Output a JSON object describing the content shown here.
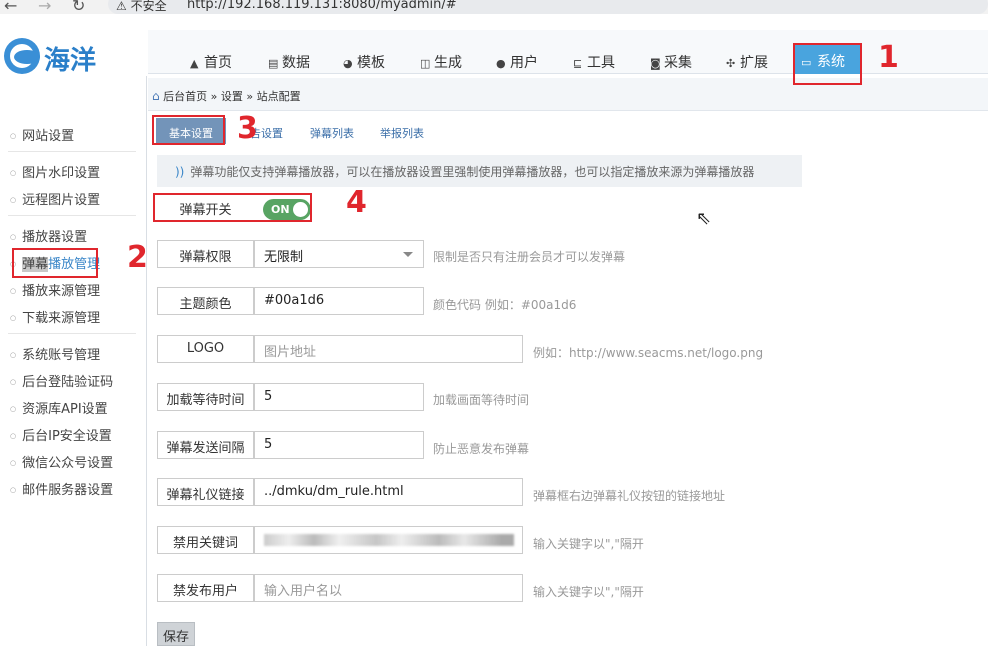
{
  "browser": {
    "security_label": "不安全",
    "url": "http://192.168.119.131:8080/myadmin/#"
  },
  "logo_text": "海洋",
  "topnav": [
    {
      "label": "首页",
      "icon": "home-icon"
    },
    {
      "label": "数据",
      "icon": "data-icon"
    },
    {
      "label": "模板",
      "icon": "palette-icon"
    },
    {
      "label": "生成",
      "icon": "generate-icon"
    },
    {
      "label": "用户",
      "icon": "user-icon"
    },
    {
      "label": "工具",
      "icon": "tools-icon"
    },
    {
      "label": "采集",
      "icon": "collect-icon"
    },
    {
      "label": "扩展",
      "icon": "extend-icon"
    },
    {
      "label": "系统",
      "icon": "monitor-icon"
    }
  ],
  "breadcrumb": "后台首页 » 设置 » 站点配置",
  "sidebar": {
    "items": [
      "网站设置",
      "图片水印设置",
      "远程图片设置",
      "播放器设置",
      "弹幕播放管理",
      "播放来源管理",
      "下载来源管理",
      "系统账号管理",
      "后台登陆验证码",
      "资源库API设置",
      "后台IP安全设置",
      "微信公众号设置",
      "邮件服务器设置"
    ],
    "active_prefix": "弹幕",
    "active_suffix": "播放管理"
  },
  "tabs": [
    "基本设置",
    "告设置",
    "弹幕列表",
    "举报列表"
  ],
  "notice": "弹幕功能仅支持弹幕播放器，可以在播放器设置里强制使用弹幕播放器，也可以指定播放来源为弹幕播放器",
  "form": {
    "switch": {
      "label": "弹幕开关",
      "state": "ON"
    },
    "permission": {
      "label": "弹幕权限",
      "value": "无限制",
      "hint": "限制是否只有注册会员才可以发弹幕"
    },
    "color": {
      "label": "主题颜色",
      "value": "#00a1d6",
      "hint": "颜色代码 例如：#00a1d6"
    },
    "logo": {
      "label": "LOGO",
      "placeholder": "图片地址",
      "hint": "例如：http://www.seacms.net/logo.png"
    },
    "load_wait": {
      "label": "加载等待时间",
      "value": "5",
      "hint": "加载画面等待时间"
    },
    "send_interval": {
      "label": "弹幕发送间隔",
      "value": "5",
      "hint": "防止恶意发布弹幕"
    },
    "rule_link": {
      "label": "弹幕礼仪链接",
      "value": "../dmku/dm_rule.html",
      "hint": "弹幕框右边弹幕礼仪按钮的链接地址"
    },
    "banned_words": {
      "label": "禁用关键词",
      "value": "",
      "hint": "输入关键字以\",\"隔开"
    },
    "banned_users": {
      "label": "禁发布用户",
      "placeholder": "输入用户名以",
      "hint": "输入关键字以\",\"隔开"
    }
  },
  "save_label": "保存",
  "annotations": [
    "1",
    "2",
    "3",
    "4"
  ],
  "colors": {
    "accent": "#49a4de",
    "annotation": "#e0262d",
    "toggle_on": "#58a463",
    "tab_active": "#7394b9"
  }
}
